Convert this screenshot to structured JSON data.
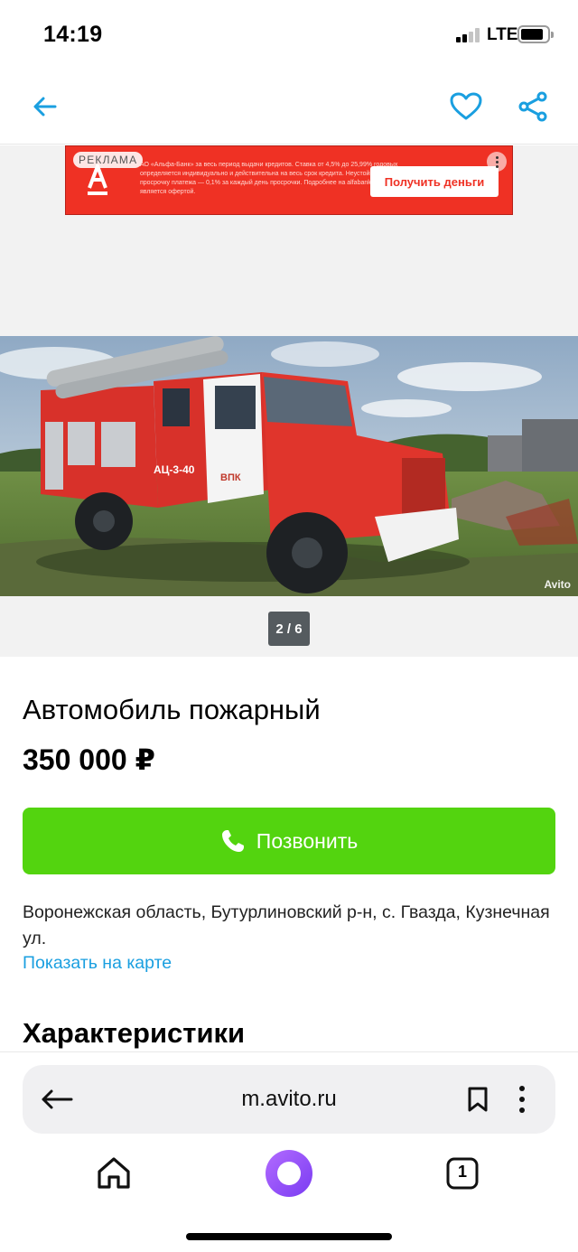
{
  "status_bar": {
    "time": "14:19",
    "network": "LTE"
  },
  "nav": {
    "back_icon": "arrow-left-icon",
    "favorite_icon": "heart-icon",
    "share_icon": "share-icon",
    "accent_color": "#1a9fe0"
  },
  "ad": {
    "badge": "РЕКЛАМА",
    "disclaimer": "АО «Альфа-Банк» за весь период выдачи кредитов. Ставка от 4,5% до 25,99% годовых определяется индивидуально и действительна на весь срок кредита. Неустойка за просрочку платежа — 0,1% за каждый день просрочки. Подробнее на alfabank.ru. Не является офертой.",
    "cta": "Получить деньги",
    "brand_color": "#ef3124"
  },
  "gallery": {
    "photo_description_icon": "fire-truck-photo",
    "watermark": "Avito",
    "counter": "2 / 6",
    "current": 2,
    "total": 6
  },
  "listing": {
    "title": "Автомобиль пожарный",
    "price": "350 000 ₽",
    "call_button": "Позвонить",
    "call_color": "#53d40f",
    "address": "Воронежская область, Бутурлиновский р-н, с. Гвазда, Кузнечная ул.",
    "map_link": "Показать на карте",
    "section_title": "Характеристики"
  },
  "browser": {
    "url": "m.avito.ru",
    "tab_count": "1"
  }
}
